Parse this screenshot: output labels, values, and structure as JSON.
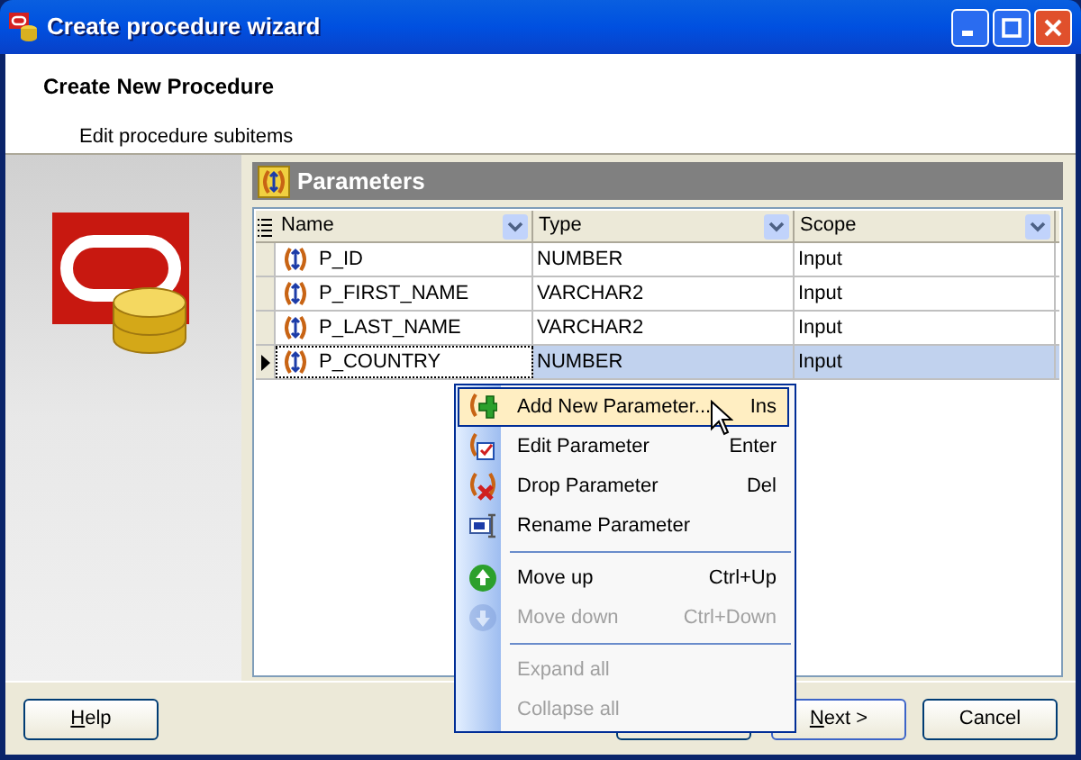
{
  "window": {
    "title": "Create procedure wizard"
  },
  "header": {
    "title": "Create New Procedure",
    "subtitle": "Edit procedure subitems"
  },
  "panel": {
    "title": "Parameters"
  },
  "table": {
    "columns": [
      "Name",
      "Type",
      "Scope"
    ],
    "rows": [
      {
        "name": "P_ID",
        "type": "NUMBER",
        "scope": "Input",
        "selected": false
      },
      {
        "name": "P_FIRST_NAME",
        "type": "VARCHAR2",
        "scope": "Input",
        "selected": false
      },
      {
        "name": "P_LAST_NAME",
        "type": "VARCHAR2",
        "scope": "Input",
        "selected": false
      },
      {
        "name": "P_COUNTRY",
        "type": "NUMBER",
        "scope": "Input",
        "selected": true
      }
    ]
  },
  "context_menu": [
    {
      "kind": "item",
      "label": "Add New Parameter...",
      "shortcut": "Ins",
      "selected": true,
      "disabled": false
    },
    {
      "kind": "item",
      "label": "Edit Parameter",
      "shortcut": "Enter",
      "selected": false,
      "disabled": false
    },
    {
      "kind": "item",
      "label": "Drop Parameter",
      "shortcut": "Del",
      "selected": false,
      "disabled": false
    },
    {
      "kind": "item",
      "label": "Rename Parameter",
      "selected": false,
      "disabled": false
    },
    {
      "kind": "separator"
    },
    {
      "kind": "item",
      "label": "Move up",
      "shortcut": "Ctrl+Up",
      "selected": false,
      "disabled": false
    },
    {
      "kind": "item",
      "label": "Move down",
      "shortcut": "Ctrl+Down",
      "selected": false,
      "disabled": true
    },
    {
      "kind": "separator"
    },
    {
      "kind": "item",
      "label": "Expand all",
      "selected": false,
      "disabled": true
    },
    {
      "kind": "item",
      "label": "Collapse all",
      "selected": false,
      "disabled": true
    }
  ],
  "buttons": {
    "help": "Help",
    "next": "Next >",
    "cancel": "Cancel"
  }
}
